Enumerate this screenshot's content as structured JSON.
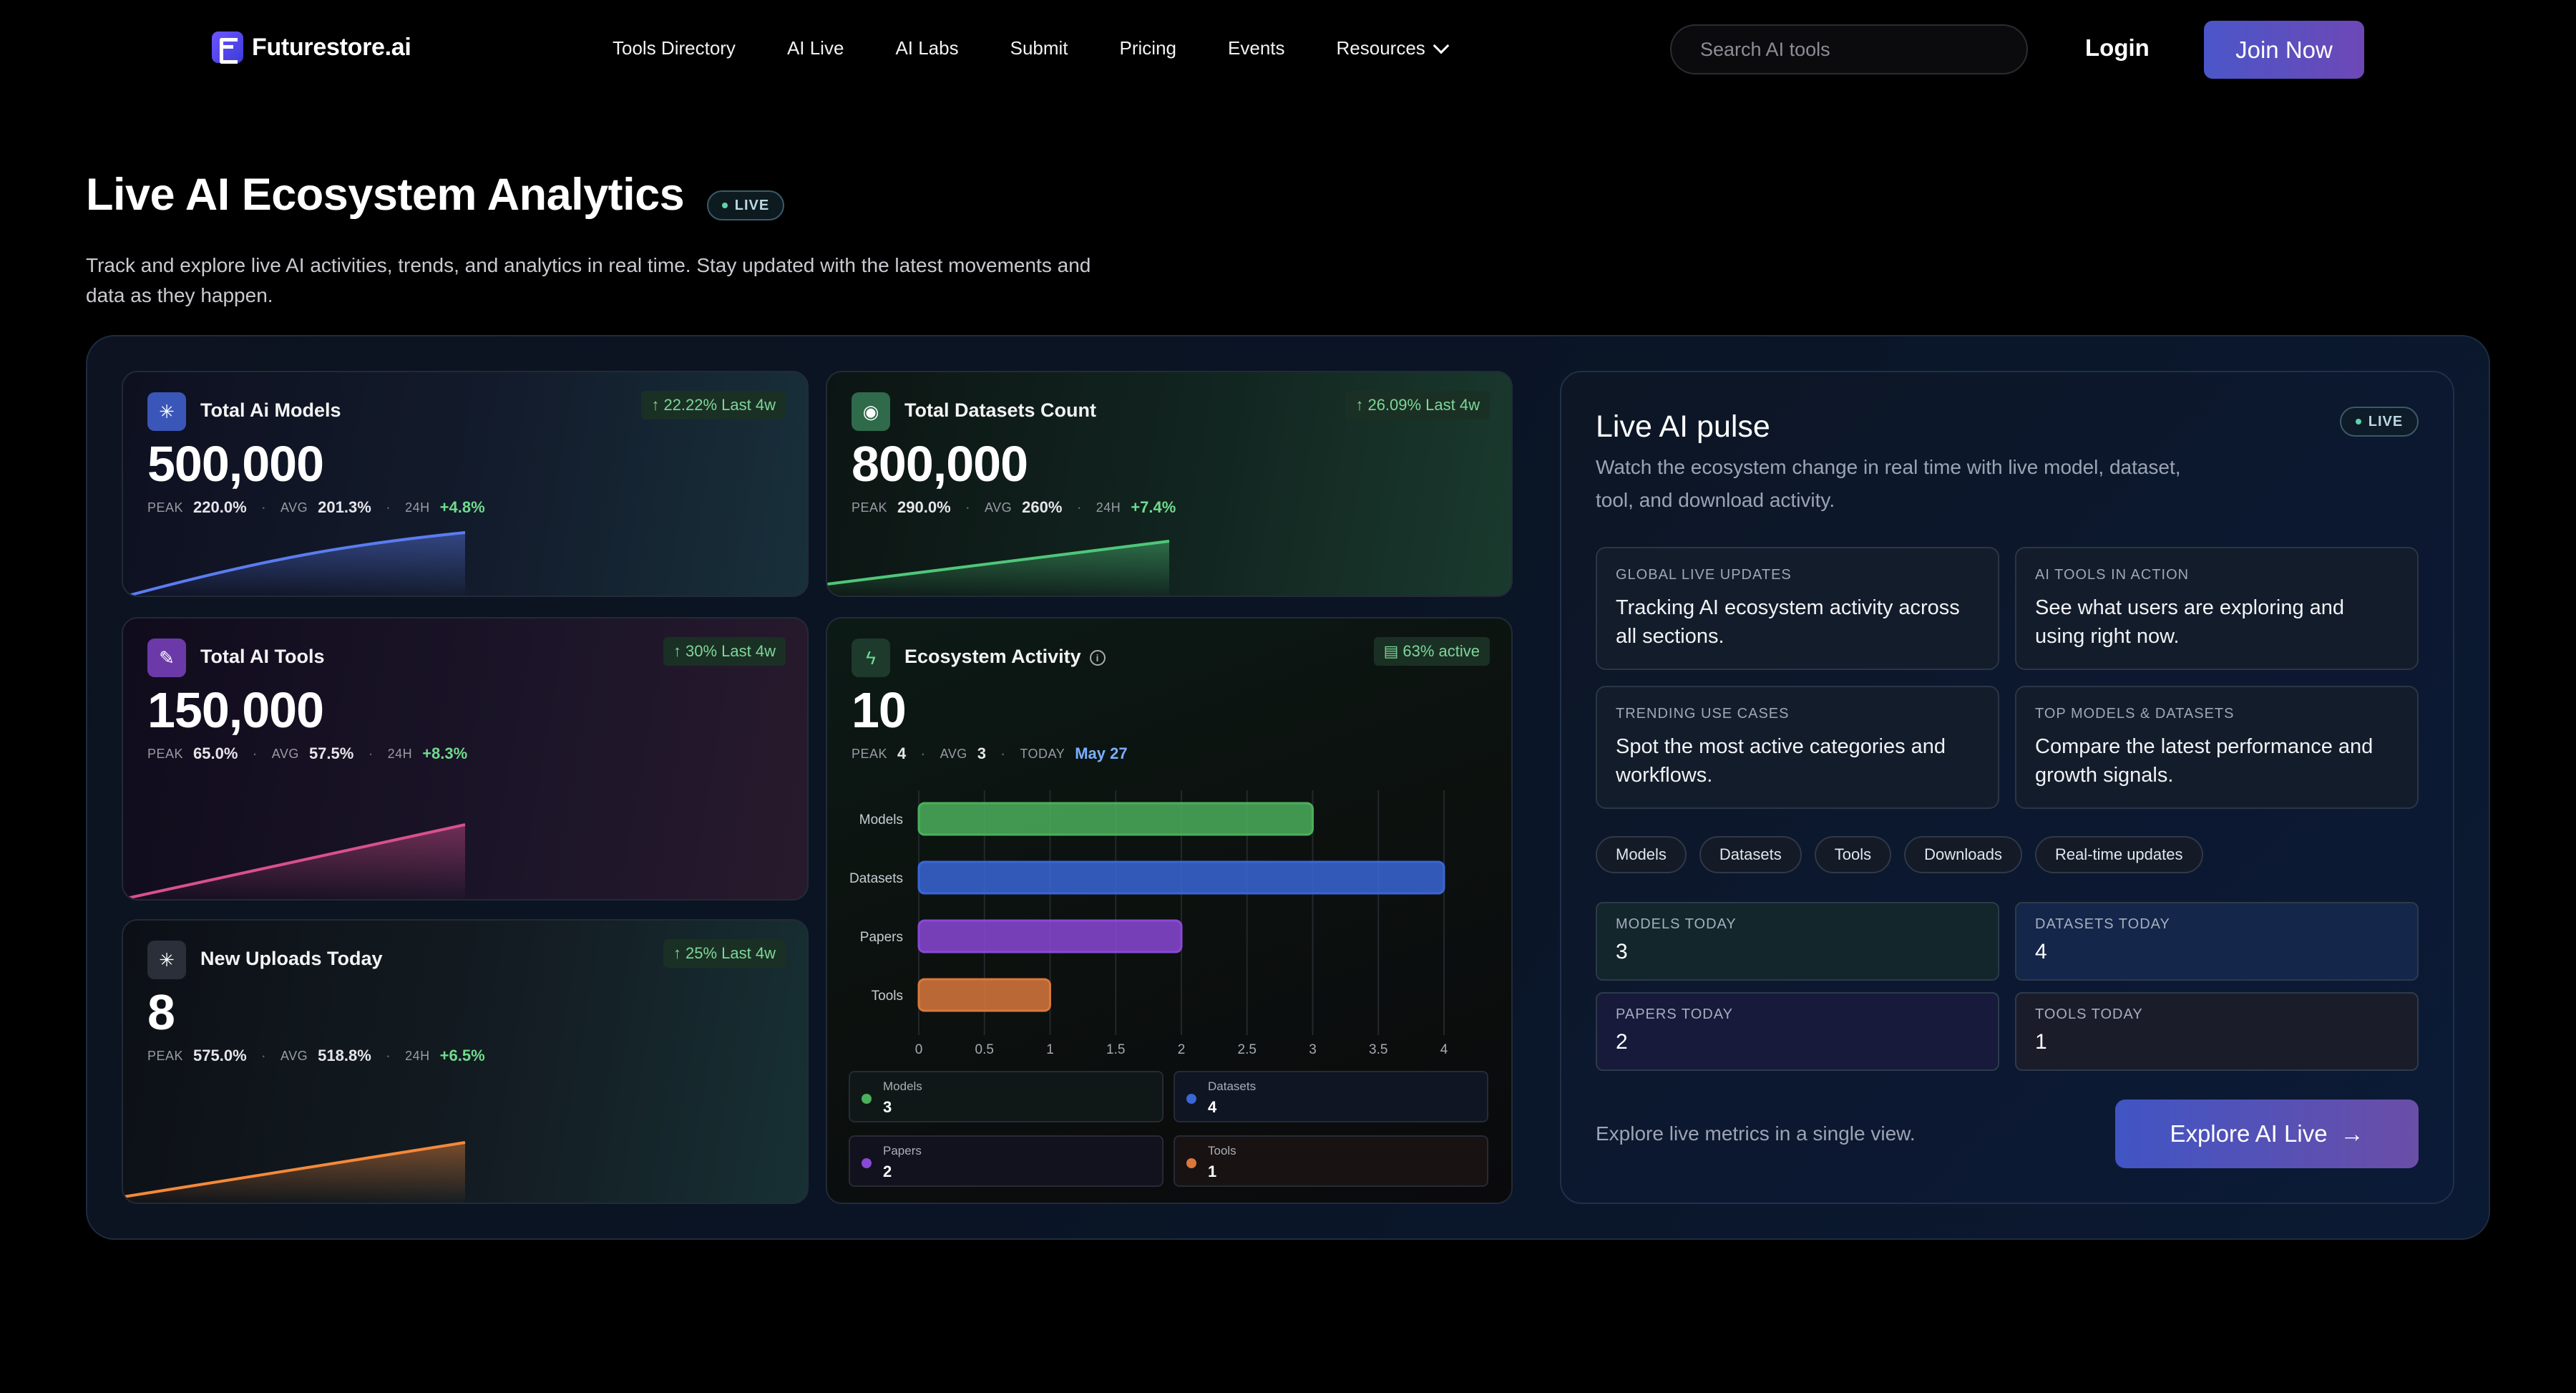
{
  "brand": {
    "name": "Futurestore.ai",
    "logo_icon": "futurestore-logo-icon"
  },
  "nav": {
    "links": [
      "Tools Directory",
      "AI Live",
      "AI Labs",
      "Submit",
      "Pricing",
      "Events",
      "Resources"
    ],
    "search_placeholder": "Search AI tools",
    "login": "Login",
    "join": "Join Now"
  },
  "hero": {
    "title": "Live AI Ecosystem Analytics",
    "live": "LIVE",
    "description": "Track and explore live AI activities, trends, and analytics in real time. Stay updated with the latest movements and data as they happen."
  },
  "cards": {
    "models": {
      "title": "Total Ai Models",
      "badge": "22.22% Last 4w",
      "value": "500,000",
      "peak_label": "PEAK",
      "peak": "220.0%",
      "avg_label": "AVG",
      "avg": "201.3%",
      "d_label": "24H",
      "d": "+4.8%",
      "color": "#5b7cf0",
      "icon": "sparkle-icon"
    },
    "datasets": {
      "title": "Total Datasets Count",
      "badge": "26.09% Last 4w",
      "value": "800,000",
      "peak_label": "PEAK",
      "peak": "290.0%",
      "avg_label": "AVG",
      "avg": "260%",
      "d_label": "24H",
      "d": "+7.4%",
      "color": "#4fc77a",
      "icon": "database-icon"
    },
    "tools": {
      "title": "Total AI Tools",
      "badge": "30% Last 4w",
      "value": "150,000",
      "peak_label": "PEAK",
      "peak": "65.0%",
      "avg_label": "AVG",
      "avg": "57.5%",
      "d_label": "24H",
      "d": "+8.3%",
      "color": "#d9508f",
      "icon": "wand-icon"
    },
    "uploads": {
      "title": "New Uploads Today",
      "badge": "25% Last 4w",
      "value": "8",
      "peak_label": "PEAK",
      "peak": "575.0%",
      "avg_label": "AVG",
      "avg": "518.8%",
      "d_label": "24H",
      "d": "+6.5%",
      "color": "#f5893a",
      "icon": "sparkle-icon"
    },
    "activity": {
      "title": "Ecosystem Activity",
      "badge": "63% active",
      "value": "10",
      "peak_label": "PEAK",
      "peak": "4",
      "avg_label": "AVG",
      "avg": "3",
      "today_label": "TODAY",
      "today": "May 27",
      "icon": "activity-icon"
    }
  },
  "chart_data": {
    "type": "bar",
    "orientation": "horizontal",
    "categories": [
      "Models",
      "Datasets",
      "Papers",
      "Tools"
    ],
    "values": [
      3,
      4,
      2,
      1
    ],
    "colors": [
      "#4caf5c",
      "#3a66d6",
      "#8a48d6",
      "#d9783c"
    ],
    "xticks": [
      "0",
      "0.5",
      "1",
      "1.5",
      "2",
      "2.5",
      "3",
      "3.5",
      "4"
    ],
    "xlim": [
      0,
      4
    ],
    "legend": [
      {
        "name": "Models",
        "value": "3"
      },
      {
        "name": "Datasets",
        "value": "4"
      },
      {
        "name": "Papers",
        "value": "2"
      },
      {
        "name": "Tools",
        "value": "1"
      }
    ]
  },
  "pulse": {
    "title": "Live AI pulse",
    "live": "LIVE",
    "description": "Watch the ecosystem change in real time with live model, dataset, tool, and download activity.",
    "features": [
      {
        "label": "GLOBAL LIVE UPDATES",
        "text": "Tracking AI ecosystem activity across all sections."
      },
      {
        "label": "AI TOOLS IN ACTION",
        "text": "See what users are exploring and using right now."
      },
      {
        "label": "TRENDING USE CASES",
        "text": "Spot the most active categories and workflows."
      },
      {
        "label": "TOP MODELS & DATASETS",
        "text": "Compare the latest performance and growth signals."
      }
    ],
    "chips": [
      "Models",
      "Datasets",
      "Tools",
      "Downloads",
      "Real-time updates"
    ],
    "tiles": [
      {
        "label": "MODELS TODAY",
        "value": "3"
      },
      {
        "label": "DATASETS TODAY",
        "value": "4"
      },
      {
        "label": "PAPERS TODAY",
        "value": "2"
      },
      {
        "label": "TOOLS TODAY",
        "value": "1"
      }
    ],
    "footer": "Explore live metrics in a single view.",
    "cta": "Explore AI Live"
  }
}
